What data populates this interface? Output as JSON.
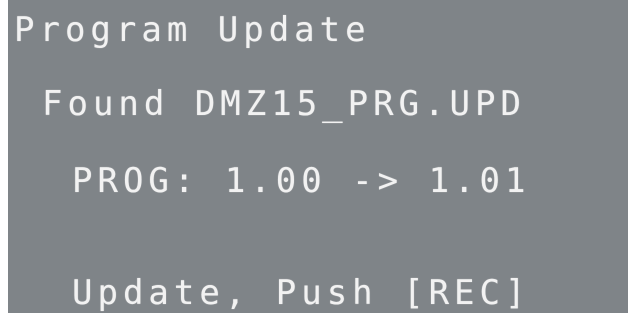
{
  "screen": {
    "title": "Program Update",
    "found_line": "Found DMZ15_PRG.UPD",
    "version_line": "PROG: 1.00 -> 1.01",
    "instruction_line": "Update, Push [REC]",
    "colors": {
      "background": "#7f8488",
      "text": "#f2f2f2"
    }
  }
}
